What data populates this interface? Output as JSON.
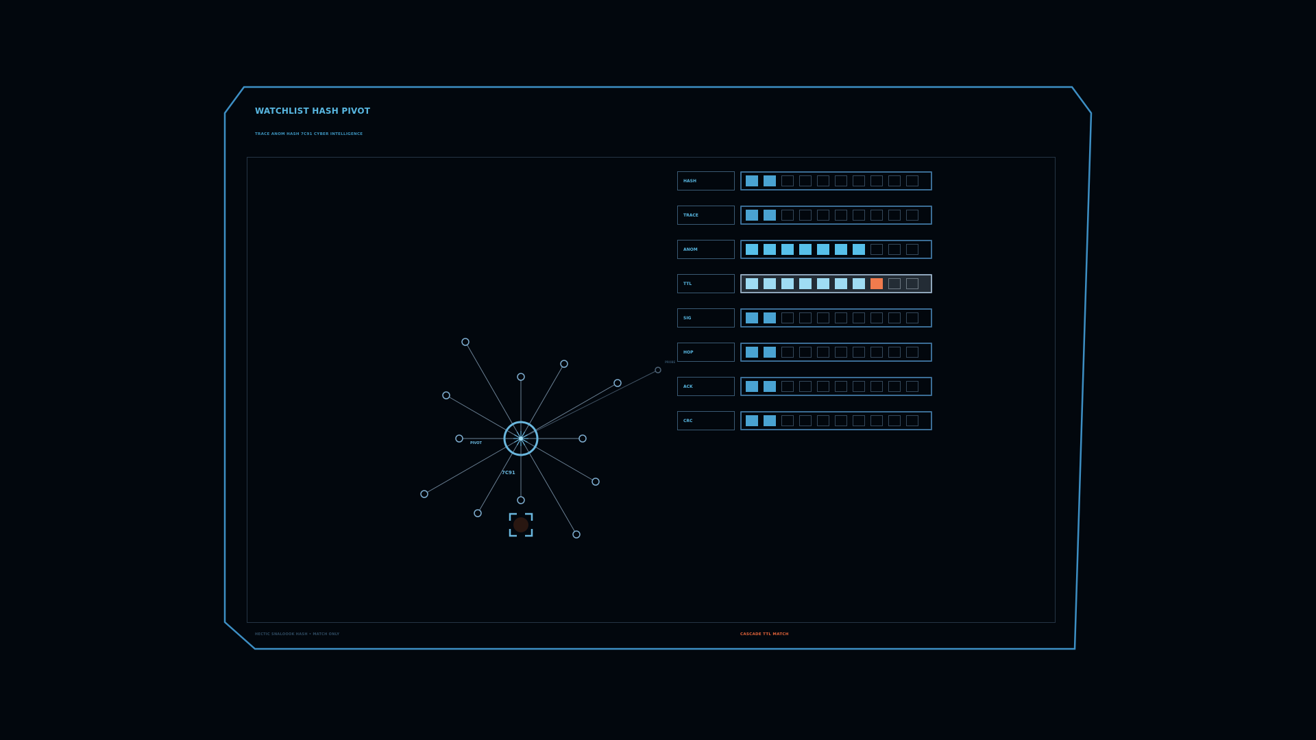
{
  "header": {
    "title": "WATCHLIST HASH PIVOT",
    "subtitle": "TRACE  ANOM  HASH 7C91  CYBER INTELLIGENCE"
  },
  "graph": {
    "pivot_label": "PIVOT",
    "hash_label": "7C91",
    "tag_label": "PROBE"
  },
  "rows": [
    {
      "label": "HASH",
      "filled": 2,
      "alert": false,
      "alert_index": null
    },
    {
      "label": "TRACE",
      "filled": 2,
      "alert": false,
      "alert_index": null
    },
    {
      "label": "ANOM",
      "filled": 7,
      "alert": false,
      "alert_index": null
    },
    {
      "label": "TTL",
      "filled": 7,
      "alert": true,
      "alert_index": 7
    },
    {
      "label": "SIG",
      "filled": 2,
      "alert": false,
      "alert_index": null
    },
    {
      "label": "HOP",
      "filled": 2,
      "alert": false,
      "alert_index": null
    },
    {
      "label": "ACK",
      "filled": 2,
      "alert": false,
      "alert_index": null
    },
    {
      "label": "CRC",
      "filled": 2,
      "alert": false,
      "alert_index": null
    }
  ],
  "segments_per_row": 10,
  "footer": {
    "left": "HECTIC SNALOOOK  HASH • MATCH ONLY",
    "right": "CASCADE TTL  MATCH"
  },
  "colors": {
    "accent": "#58b6e0",
    "frame": "#3d8fc4",
    "alert": "#f07b4d",
    "seg_low": "#4aa3d2",
    "seg_high": "#57c0ea",
    "seg_ttl": "#9fdcf3"
  }
}
